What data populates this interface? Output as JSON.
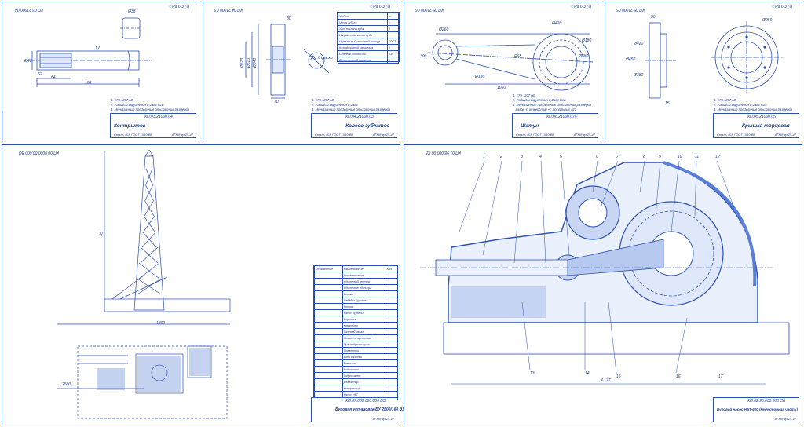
{
  "sheets": {
    "s1": {
      "frame_title": "КП.03.21000.04",
      "roughness": "√ Ra 6,3 (√)",
      "notes": "1. 179...207 НВ\n2. Радиусы скругления 0,2 мм max\n3. Неуказанные предельные отклонения размеров\n   валов -t, отверстий +t, остальных ±t/2",
      "stamp_code": "КП.03.21000.04",
      "stamp_name": "Контршток",
      "stamp_material": "Сталь 40Х ГОСТ 1050-88",
      "stamp_org": "АГНИ гр.25-47",
      "dims": [
        "Ø38",
        "1,6",
        "Ø48",
        "62",
        "64",
        "166"
      ]
    },
    "s2": {
      "frame_title": "КП.04.21000.03",
      "roughness": "√ Ra 6,3 (√)",
      "notes": "1. 179...207 НВ\n2. Радиусы скругления 0,2 мм\n3. Неуказанные предельные отклонения размеров\n   валов -t, отверстий +t, остальных ±t/2",
      "stamp_code": "КП.04.21000.03",
      "stamp_name": "Колесо зубчатое",
      "stamp_material": "Сталь 40Х ГОСТ 1050-88",
      "stamp_org": "АГНИ гр.25-47",
      "dims": [
        "Ø640",
        "Ø610",
        "Ø520",
        "70",
        "80",
        "6 фаски"
      ],
      "params": [
        "Модуль",
        "Число зубьев",
        "Угол наклона зуба",
        "Направление линии зуба",
        "Нормальный исходный контур",
        "Коэффициент смещения",
        "Степень точности",
        "Делительный диаметр"
      ],
      "param_values": [
        "m",
        "z",
        "β",
        "",
        "ГОСТ",
        "0",
        "8-В",
        "d"
      ]
    },
    "s3": {
      "frame_title": "КП.05.21000.06",
      "roughness": "√ Ra 6,3 (√)",
      "notes": "1. 179...207 НВ\n2. Радиусы скругления 0,2 мм max\n3. Неуказанные предельные отклонения размеров\n   валов -t, отверстий +t, остальных ±t/2",
      "stamp_code": "КП.06.21000.076",
      "stamp_name": "Шатун",
      "stamp_material": "Сталь 40Х ГОСТ 1050-88",
      "stamp_org": "АГНИ гр.25-47",
      "dims": [
        "Ø420",
        "Ø260",
        "Ø380",
        "Ø130",
        "Ø180",
        "R65",
        "1050",
        "300"
      ]
    },
    "s4": {
      "frame_title": "КП.05.21000.05",
      "roughness": "√ Ra 6,3 (√)",
      "notes": "1. 179...207 НВ\n2. Радиусы скругления 0,2 мм тах\n3. Неуказанные предельные отклонения размеров\n   валов -t, отверстий +t, остальных ±t/2",
      "stamp_code": "КП.05.21000.05",
      "stamp_name": "Крышка торцевая",
      "stamp_material": "Сталь 40Х ГОСТ 1050-88",
      "stamp_org": "АГНИ гр.25-47",
      "dims": [
        "Ø450",
        "Ø420",
        "Ø380",
        "Ø260",
        "30",
        "15"
      ]
    },
    "s5": {
      "frame_title": "КП.00.0000.00.000 ВО",
      "stamp_code": "КП.07.000.000.000 ВО",
      "stamp_name": "Буровая установка БУ 2500/160 ЭУ",
      "stamp_org": "АГНИ гр.25-47",
      "spec_header": [
        "Обозначение",
        "Наименование",
        "Кол."
      ],
      "spec_rows": [
        "Документация",
        "Сборочный чертёж",
        "Сборочные единицы",
        "Вышка",
        "Лебёдка буровая",
        "Ротор",
        "Насос буровой",
        "Вертлюг",
        "Крюкоблок",
        "Талевый канат",
        "Механизм крепления",
        "Пульт бурильщика",
        "Превентор",
        "Блок очистки",
        "Ёмкость",
        "Вибросито",
        "Гидроциклон",
        "Дегазатор",
        "Компрессор",
        "Насос НБТ",
        "Основание",
        "Привод",
        "Трансмиссия",
        "Манифольд",
        "Стояк",
        "Рукав",
        "Шланг"
      ],
      "dims": [
        "45",
        "1800",
        "2500"
      ]
    },
    "s6": {
      "frame_title": "КП.01.98.000.00 СБ",
      "stamp_code": "КП.02.98.000.000 СБ",
      "stamp_name": "Буровой насос НБТ-600 (Редукторная часть)",
      "stamp_org": "АГНИ гр.25-47",
      "callouts": [
        "1",
        "2",
        "3",
        "4",
        "5",
        "6",
        "7",
        "8",
        "9",
        "10",
        "11",
        "12",
        "13",
        "14",
        "15",
        "16",
        "17"
      ],
      "dims": [
        "4 177"
      ]
    }
  },
  "colors": {
    "line": "#2a4fb0",
    "fill": "#5a7fd6",
    "light": "#a9bde8"
  }
}
